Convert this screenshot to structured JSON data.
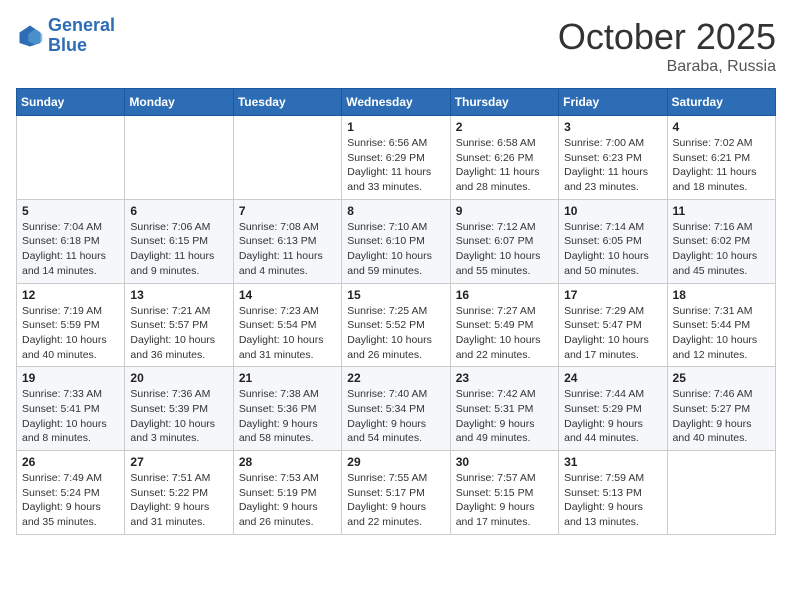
{
  "header": {
    "logo_line1": "General",
    "logo_line2": "Blue",
    "month": "October 2025",
    "location": "Baraba, Russia"
  },
  "days_of_week": [
    "Sunday",
    "Monday",
    "Tuesday",
    "Wednesday",
    "Thursday",
    "Friday",
    "Saturday"
  ],
  "weeks": [
    [
      {
        "day": "",
        "info": ""
      },
      {
        "day": "",
        "info": ""
      },
      {
        "day": "",
        "info": ""
      },
      {
        "day": "1",
        "info": "Sunrise: 6:56 AM\nSunset: 6:29 PM\nDaylight: 11 hours\nand 33 minutes."
      },
      {
        "day": "2",
        "info": "Sunrise: 6:58 AM\nSunset: 6:26 PM\nDaylight: 11 hours\nand 28 minutes."
      },
      {
        "day": "3",
        "info": "Sunrise: 7:00 AM\nSunset: 6:23 PM\nDaylight: 11 hours\nand 23 minutes."
      },
      {
        "day": "4",
        "info": "Sunrise: 7:02 AM\nSunset: 6:21 PM\nDaylight: 11 hours\nand 18 minutes."
      }
    ],
    [
      {
        "day": "5",
        "info": "Sunrise: 7:04 AM\nSunset: 6:18 PM\nDaylight: 11 hours\nand 14 minutes."
      },
      {
        "day": "6",
        "info": "Sunrise: 7:06 AM\nSunset: 6:15 PM\nDaylight: 11 hours\nand 9 minutes."
      },
      {
        "day": "7",
        "info": "Sunrise: 7:08 AM\nSunset: 6:13 PM\nDaylight: 11 hours\nand 4 minutes."
      },
      {
        "day": "8",
        "info": "Sunrise: 7:10 AM\nSunset: 6:10 PM\nDaylight: 10 hours\nand 59 minutes."
      },
      {
        "day": "9",
        "info": "Sunrise: 7:12 AM\nSunset: 6:07 PM\nDaylight: 10 hours\nand 55 minutes."
      },
      {
        "day": "10",
        "info": "Sunrise: 7:14 AM\nSunset: 6:05 PM\nDaylight: 10 hours\nand 50 minutes."
      },
      {
        "day": "11",
        "info": "Sunrise: 7:16 AM\nSunset: 6:02 PM\nDaylight: 10 hours\nand 45 minutes."
      }
    ],
    [
      {
        "day": "12",
        "info": "Sunrise: 7:19 AM\nSunset: 5:59 PM\nDaylight: 10 hours\nand 40 minutes."
      },
      {
        "day": "13",
        "info": "Sunrise: 7:21 AM\nSunset: 5:57 PM\nDaylight: 10 hours\nand 36 minutes."
      },
      {
        "day": "14",
        "info": "Sunrise: 7:23 AM\nSunset: 5:54 PM\nDaylight: 10 hours\nand 31 minutes."
      },
      {
        "day": "15",
        "info": "Sunrise: 7:25 AM\nSunset: 5:52 PM\nDaylight: 10 hours\nand 26 minutes."
      },
      {
        "day": "16",
        "info": "Sunrise: 7:27 AM\nSunset: 5:49 PM\nDaylight: 10 hours\nand 22 minutes."
      },
      {
        "day": "17",
        "info": "Sunrise: 7:29 AM\nSunset: 5:47 PM\nDaylight: 10 hours\nand 17 minutes."
      },
      {
        "day": "18",
        "info": "Sunrise: 7:31 AM\nSunset: 5:44 PM\nDaylight: 10 hours\nand 12 minutes."
      }
    ],
    [
      {
        "day": "19",
        "info": "Sunrise: 7:33 AM\nSunset: 5:41 PM\nDaylight: 10 hours\nand 8 minutes."
      },
      {
        "day": "20",
        "info": "Sunrise: 7:36 AM\nSunset: 5:39 PM\nDaylight: 10 hours\nand 3 minutes."
      },
      {
        "day": "21",
        "info": "Sunrise: 7:38 AM\nSunset: 5:36 PM\nDaylight: 9 hours\nand 58 minutes."
      },
      {
        "day": "22",
        "info": "Sunrise: 7:40 AM\nSunset: 5:34 PM\nDaylight: 9 hours\nand 54 minutes."
      },
      {
        "day": "23",
        "info": "Sunrise: 7:42 AM\nSunset: 5:31 PM\nDaylight: 9 hours\nand 49 minutes."
      },
      {
        "day": "24",
        "info": "Sunrise: 7:44 AM\nSunset: 5:29 PM\nDaylight: 9 hours\nand 44 minutes."
      },
      {
        "day": "25",
        "info": "Sunrise: 7:46 AM\nSunset: 5:27 PM\nDaylight: 9 hours\nand 40 minutes."
      }
    ],
    [
      {
        "day": "26",
        "info": "Sunrise: 7:49 AM\nSunset: 5:24 PM\nDaylight: 9 hours\nand 35 minutes."
      },
      {
        "day": "27",
        "info": "Sunrise: 7:51 AM\nSunset: 5:22 PM\nDaylight: 9 hours\nand 31 minutes."
      },
      {
        "day": "28",
        "info": "Sunrise: 7:53 AM\nSunset: 5:19 PM\nDaylight: 9 hours\nand 26 minutes."
      },
      {
        "day": "29",
        "info": "Sunrise: 7:55 AM\nSunset: 5:17 PM\nDaylight: 9 hours\nand 22 minutes."
      },
      {
        "day": "30",
        "info": "Sunrise: 7:57 AM\nSunset: 5:15 PM\nDaylight: 9 hours\nand 17 minutes."
      },
      {
        "day": "31",
        "info": "Sunrise: 7:59 AM\nSunset: 5:13 PM\nDaylight: 9 hours\nand 13 minutes."
      },
      {
        "day": "",
        "info": ""
      }
    ]
  ]
}
